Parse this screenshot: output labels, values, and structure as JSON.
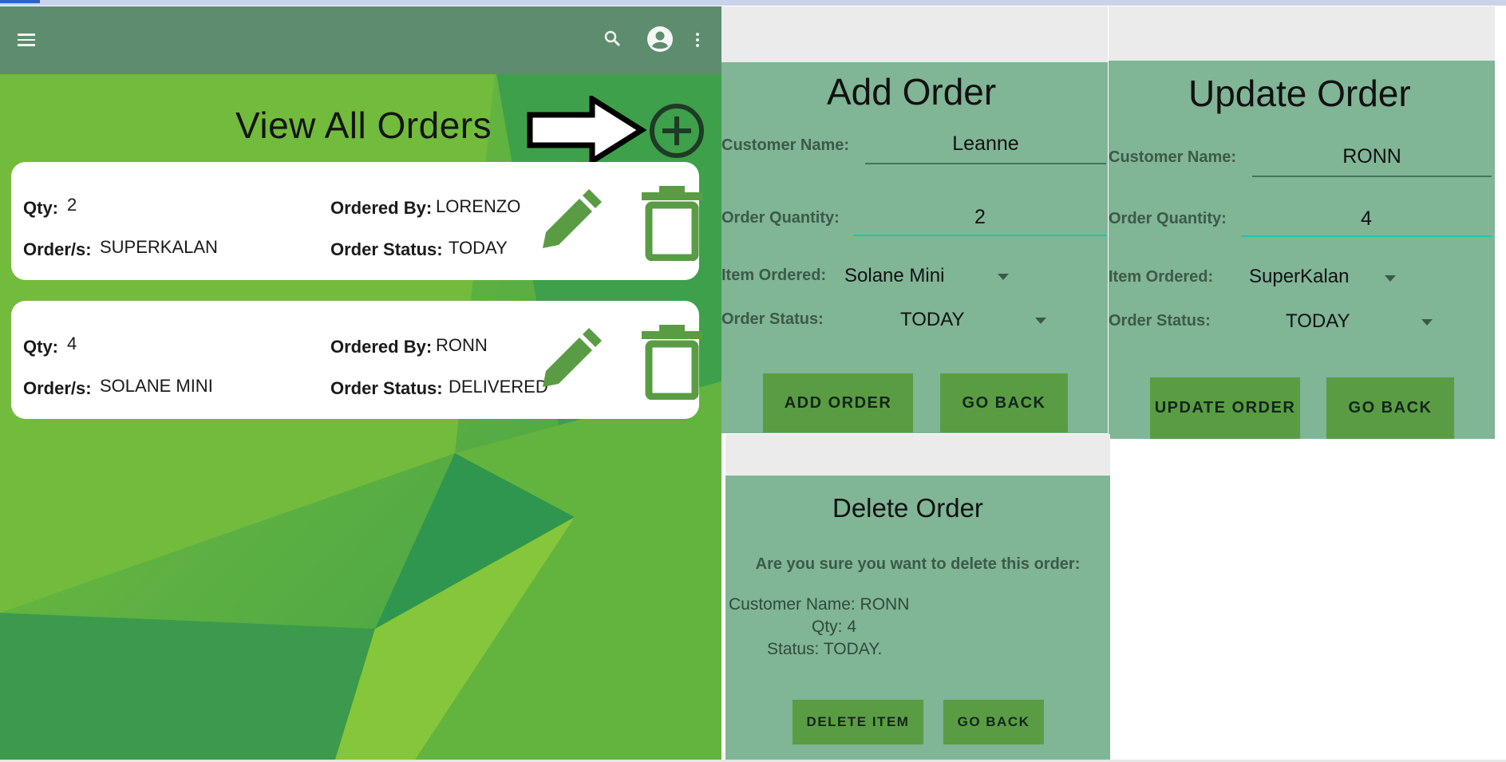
{
  "colors": {
    "appbar": "#5d8d6e",
    "panel_bg": "#80b596",
    "button": "#5a9c44",
    "icon_green": "#5a9c44",
    "teal_underline": "#1fc4b7"
  },
  "view_orders": {
    "title": "View All Orders",
    "orders": [
      {
        "qty_label": "Qty:",
        "qty": "2",
        "orders_label": "Order/s:",
        "item": "SUPERKALAN",
        "by_label": "Ordered By:",
        "by": "LORENZO",
        "status_label": "Order Status:",
        "status": "TODAY"
      },
      {
        "qty_label": "Qty:",
        "qty": "4",
        "orders_label": "Order/s:",
        "item": "SOLANE MINI",
        "by_label": "Ordered By:",
        "by": "RONN",
        "status_label": "Order Status:",
        "status": "DELIVERED"
      }
    ]
  },
  "add_order": {
    "title": "Add Order",
    "customer_label": "Customer Name:",
    "customer_value": "Leanne",
    "qty_label": "Order Quantity:",
    "qty_value": "2",
    "item_label": "Item Ordered:",
    "item_value": "Solane Mini",
    "status_label": "Order Status:",
    "status_value": "TODAY",
    "primary_button": "ADD ORDER",
    "back_button": "GO BACK"
  },
  "update_order": {
    "title": "Update Order",
    "customer_label": "Customer Name:",
    "customer_value": "RONN",
    "qty_label": "Order Quantity:",
    "qty_value": "4",
    "item_label": "Item Ordered:",
    "item_value": "SuperKalan",
    "status_label": "Order Status:",
    "status_value": "TODAY",
    "primary_button": "UPDATE ORDER",
    "back_button": "GO BACK"
  },
  "delete_order": {
    "title": "Delete Order",
    "prompt": "Are you sure you want to delete this order:",
    "customer_line": "Customer Name: RONN",
    "qty_line": "Qty: 4",
    "status_line": "Status: TODAY.",
    "primary_button": "DELETE ITEM",
    "back_button": "GO BACK"
  }
}
